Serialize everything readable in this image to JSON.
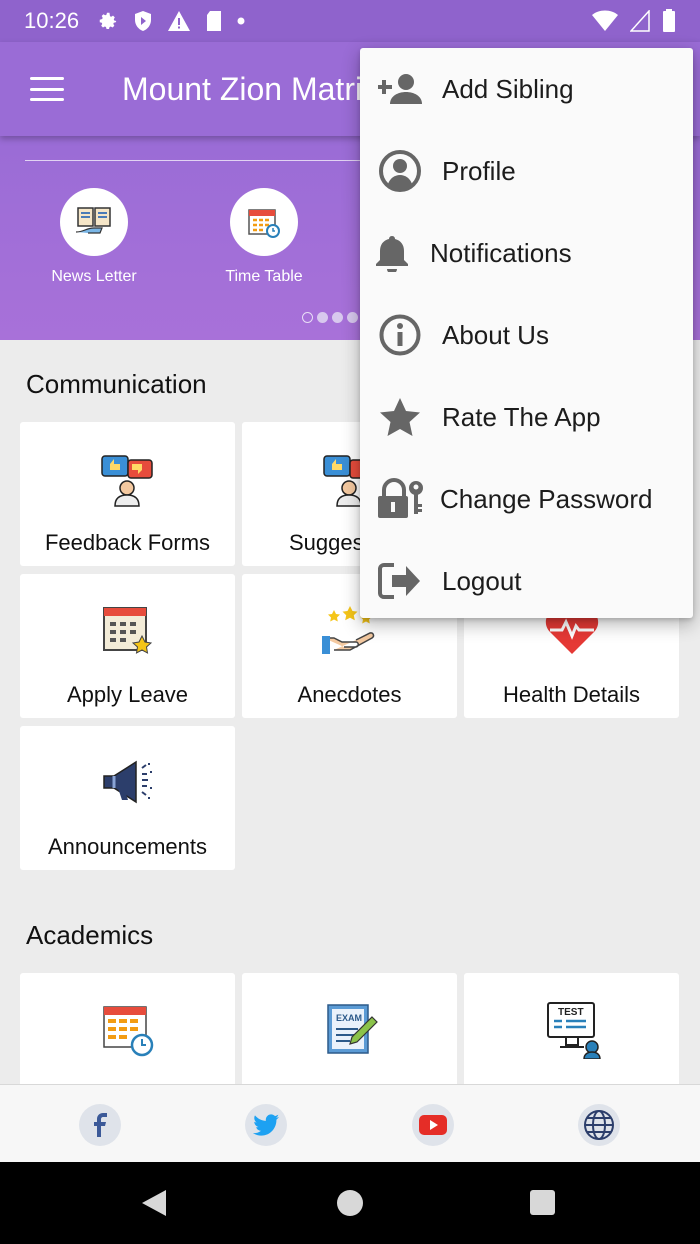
{
  "status_bar": {
    "time": "10:26"
  },
  "app_bar": {
    "title": "Mount Zion Matriculation School"
  },
  "banner": {
    "items": [
      {
        "label": "News Letter",
        "icon": "newsletter-icon"
      },
      {
        "label": "Time Table",
        "icon": "timetable-icon"
      }
    ]
  },
  "sections": {
    "communication": {
      "title": "Communication",
      "cards": [
        {
          "label": "Feedback Forms",
          "icon": "feedback-icon"
        },
        {
          "label": "Suggestions",
          "icon": "suggestion-icon"
        },
        {
          "label": "Health Details",
          "icon": "health-icon"
        },
        {
          "label": "Apply Leave",
          "icon": "calendar-star-icon"
        },
        {
          "label": "Anecdotes",
          "icon": "hand-stars-icon"
        },
        {
          "label": "Announcements",
          "icon": "megaphone-icon"
        }
      ]
    },
    "academics": {
      "title": "Academics",
      "cards": [
        {
          "icon": "calendar-clock-icon"
        },
        {
          "icon": "exam-icon"
        },
        {
          "icon": "test-icon"
        }
      ]
    }
  },
  "social": [
    "facebook-icon",
    "twitter-icon",
    "youtube-icon",
    "globe-icon"
  ],
  "menu": {
    "items": [
      {
        "label": "Add Sibling",
        "icon": "add-person-icon"
      },
      {
        "label": "Profile",
        "icon": "profile-icon"
      },
      {
        "label": "Notifications",
        "icon": "bell-icon"
      },
      {
        "label": "About Us",
        "icon": "info-icon"
      },
      {
        "label": "Rate The App",
        "icon": "star-icon"
      },
      {
        "label": "Change Password",
        "icon": "lock-key-icon"
      },
      {
        "label": "Logout",
        "icon": "logout-icon"
      }
    ]
  },
  "colors": {
    "primary": "#9a6cd6",
    "status_bar": "#8f63cc",
    "background": "#ececec"
  }
}
